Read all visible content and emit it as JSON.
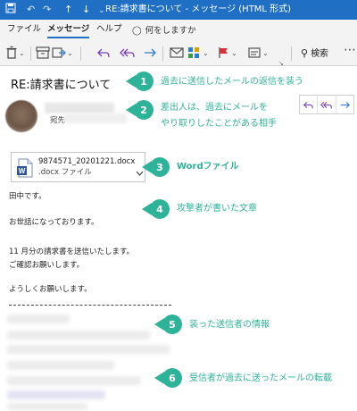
{
  "titlebar": {
    "title": "RE:請求書について - メッセージ (HTML 形式)"
  },
  "menu": {
    "file": "ファイル",
    "message": "メッセージ",
    "help": "ヘルプ",
    "tell_me": "何をしますか"
  },
  "toolbar": {
    "search_label": "検索"
  },
  "message": {
    "subject": "RE:請求書について",
    "to_label": "宛先",
    "attachment": {
      "name": "9874571_20201221.docx",
      "type": ".docx ファイル"
    },
    "body_lines": [
      "田中です。",
      "お世話になっております。",
      "11 月分の請求書を送信いたします。",
      "ご確認お願いします。",
      "ようしくお願いします。"
    ]
  },
  "annotations": [
    {
      "number": "1",
      "text": "過去に送信したメールの返信を装う"
    },
    {
      "number": "2",
      "text_line1": "差出人は、過去にメールを",
      "text_line2": "やり取りしたことがある相手"
    },
    {
      "number": "3",
      "text": "Wordファイル"
    },
    {
      "number": "4",
      "text": "攻撃者が書いた文章"
    },
    {
      "number": "5",
      "text": "装った送信者の情報"
    },
    {
      "number": "6",
      "text": "受信者が過去に送ったメールの転載"
    }
  ],
  "colors": {
    "titlebar": "#1f6fc5",
    "annotation": "#2fb398",
    "word_blue": "#2b579a"
  }
}
